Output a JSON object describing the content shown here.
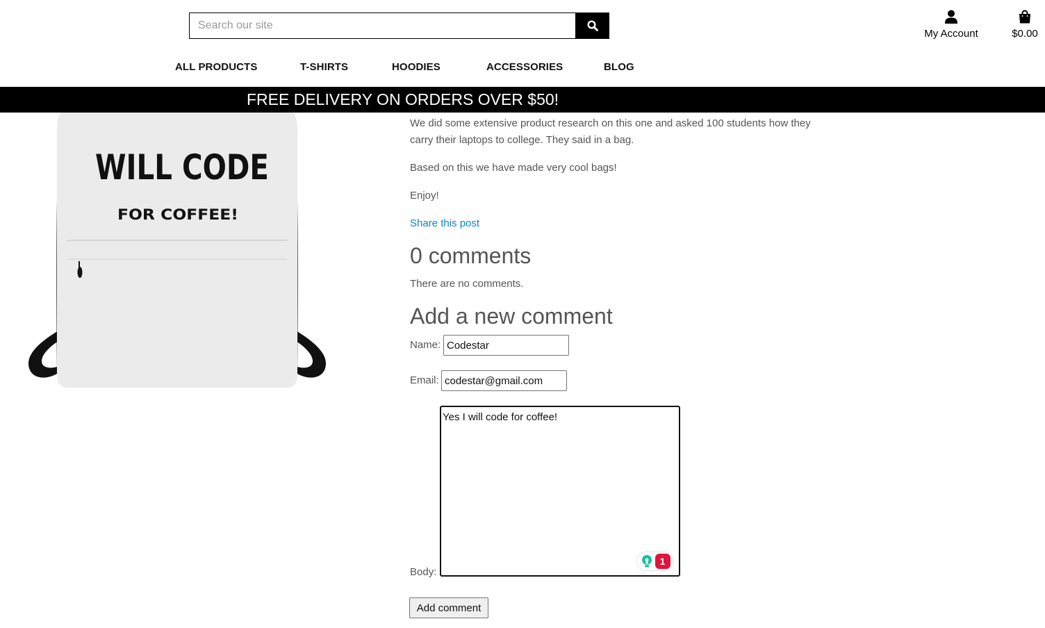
{
  "header": {
    "search": {
      "placeholder": "Search our site",
      "value": ""
    },
    "account_label": "My Account",
    "bag_total": "$0.00"
  },
  "nav": {
    "items": [
      {
        "label": "ALL PRODUCTS"
      },
      {
        "label": "T-SHIRTS"
      },
      {
        "label": "HOODIES"
      },
      {
        "label": "ACCESSORIES"
      },
      {
        "label": "BLOG"
      }
    ]
  },
  "banner": {
    "text": "FREE DELIVERY ON ORDERS OVER $50!"
  },
  "product_image": {
    "line1": "WILL CODE",
    "line2": "FOR COFFEE!"
  },
  "post": {
    "paragraphs": [
      "We did some extensive product research on this one and asked 100 students how they carry their laptops to college. They said in a bag.",
      "Based on this we have made very cool bags!",
      "Enjoy!"
    ],
    "share_link": "Share this post"
  },
  "comments": {
    "count_heading": "0 comments",
    "empty_text": "There are no comments."
  },
  "form": {
    "heading": "Add a new comment",
    "name_label": "Name:",
    "name_value": "Codestar",
    "email_label": "Email:",
    "email_value": "codestar@gmail.com",
    "body_label": "Body:",
    "body_value": "Yes I will code for coffee!",
    "submit_label": "Add comment"
  },
  "grammar_widget": {
    "issue_count": "1"
  },
  "colors": {
    "link": "#0a84d6",
    "banner_bg": "#000000",
    "text": "#555555",
    "grammar_red": "#e1143c",
    "grammar_green": "#15c39a"
  }
}
